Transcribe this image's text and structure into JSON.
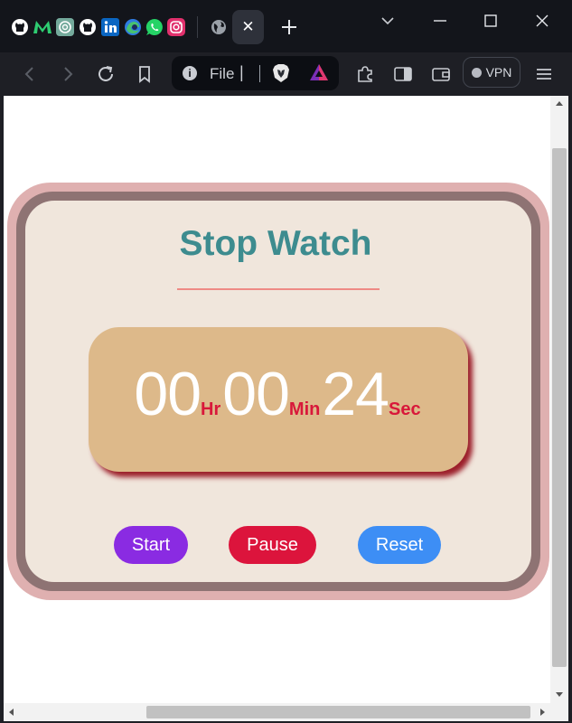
{
  "browser": {
    "tabs": [
      {
        "icon": "github-icon",
        "color": "#ffffff"
      },
      {
        "icon": "medium-icon",
        "color": "#2ecc71"
      },
      {
        "icon": "chatgpt-icon",
        "color": "#74aa9c"
      },
      {
        "icon": "github-icon",
        "color": "#ffffff"
      },
      {
        "icon": "linkedin-icon",
        "color": "#0a66c2"
      },
      {
        "icon": "edge-icon",
        "color": "#2f7be0"
      },
      {
        "icon": "whatsapp-icon",
        "color": "#25d366"
      },
      {
        "icon": "instagram-icon",
        "color": "#e1306c"
      },
      {
        "icon": "globe-icon",
        "color": "#9aa0a8"
      }
    ],
    "active_tab_close": "✕",
    "new_tab": "+",
    "address": {
      "scheme_label": "File",
      "cursor": "|"
    },
    "vpn_label": "VPN"
  },
  "stopwatch": {
    "title": "Stop Watch",
    "hours": "00",
    "hours_unit": "Hr",
    "minutes": "00",
    "minutes_unit": "Min",
    "seconds": "24",
    "seconds_unit": "Sec",
    "buttons": {
      "start": "Start",
      "pause": "Pause",
      "reset": "Reset"
    },
    "colors": {
      "title": "#3d8c8f",
      "display_bg": "#ddb98a",
      "unit": "#d8183a",
      "start": "#8a2be2",
      "pause": "#dc143c",
      "reset": "#3d8ef5"
    }
  }
}
